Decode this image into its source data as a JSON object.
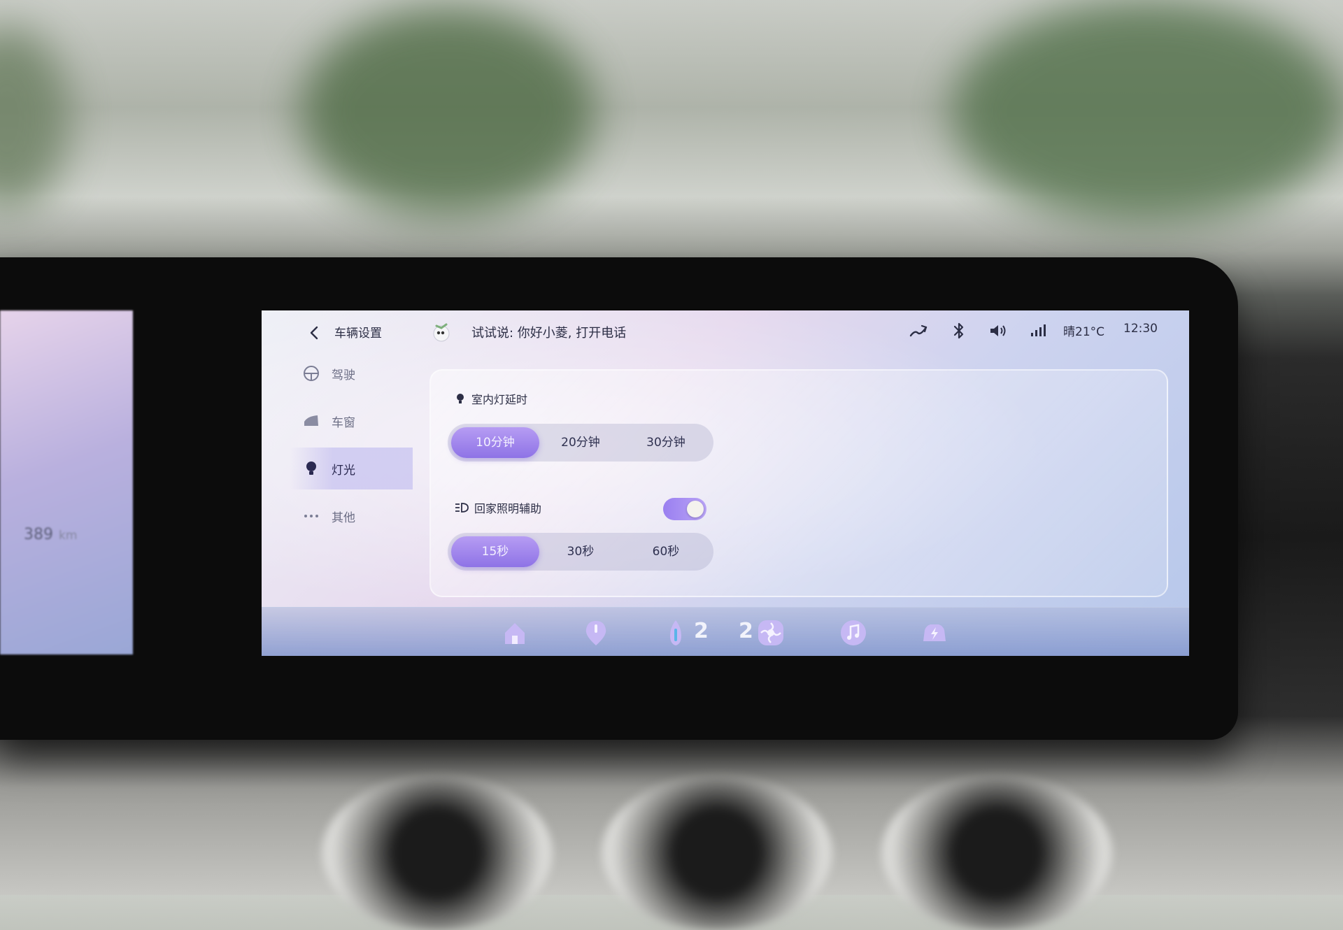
{
  "cluster": {
    "range_value": "389",
    "range_unit": "km"
  },
  "header": {
    "back_icon": "chevron-left-icon",
    "title": "车辆设置",
    "voice_hint": "试试说: 你好小菱, 打开电话"
  },
  "status_bar": {
    "icons": [
      "signal-wave-icon",
      "bluetooth-icon",
      "volume-icon",
      "cellular-signal-icon"
    ],
    "weather": "晴21°C",
    "time": "12:30"
  },
  "sidebar": {
    "items": [
      {
        "label": "驾驶",
        "icon": "steering-wheel-icon",
        "active": false
      },
      {
        "label": "车窗",
        "icon": "car-window-icon",
        "active": false
      },
      {
        "label": "灯光",
        "icon": "light-bulb-icon",
        "active": true
      },
      {
        "label": "其他",
        "icon": "more-dots-icon",
        "active": false
      }
    ]
  },
  "interior_light": {
    "label": "室内灯延时",
    "options": [
      "10分钟",
      "20分钟",
      "30分钟"
    ],
    "selected": "10分钟"
  },
  "home_lighting": {
    "label": "回家照明辅助",
    "enabled": true,
    "options": [
      "15秒",
      "30秒",
      "60秒"
    ],
    "selected": "15秒"
  },
  "dock": {
    "items": [
      {
        "icon": "home-icon"
      },
      {
        "icon": "navigation-pin-icon"
      },
      {
        "icon": "temperature-icon",
        "value": "2"
      },
      {
        "icon": "fan-icon",
        "value": "2"
      },
      {
        "icon": "music-icon"
      },
      {
        "icon": "charging-car-icon"
      }
    ]
  },
  "colors": {
    "accent": "#9478e8",
    "text_primary": "#2c2e45",
    "screen_background": "#e6dcef"
  }
}
